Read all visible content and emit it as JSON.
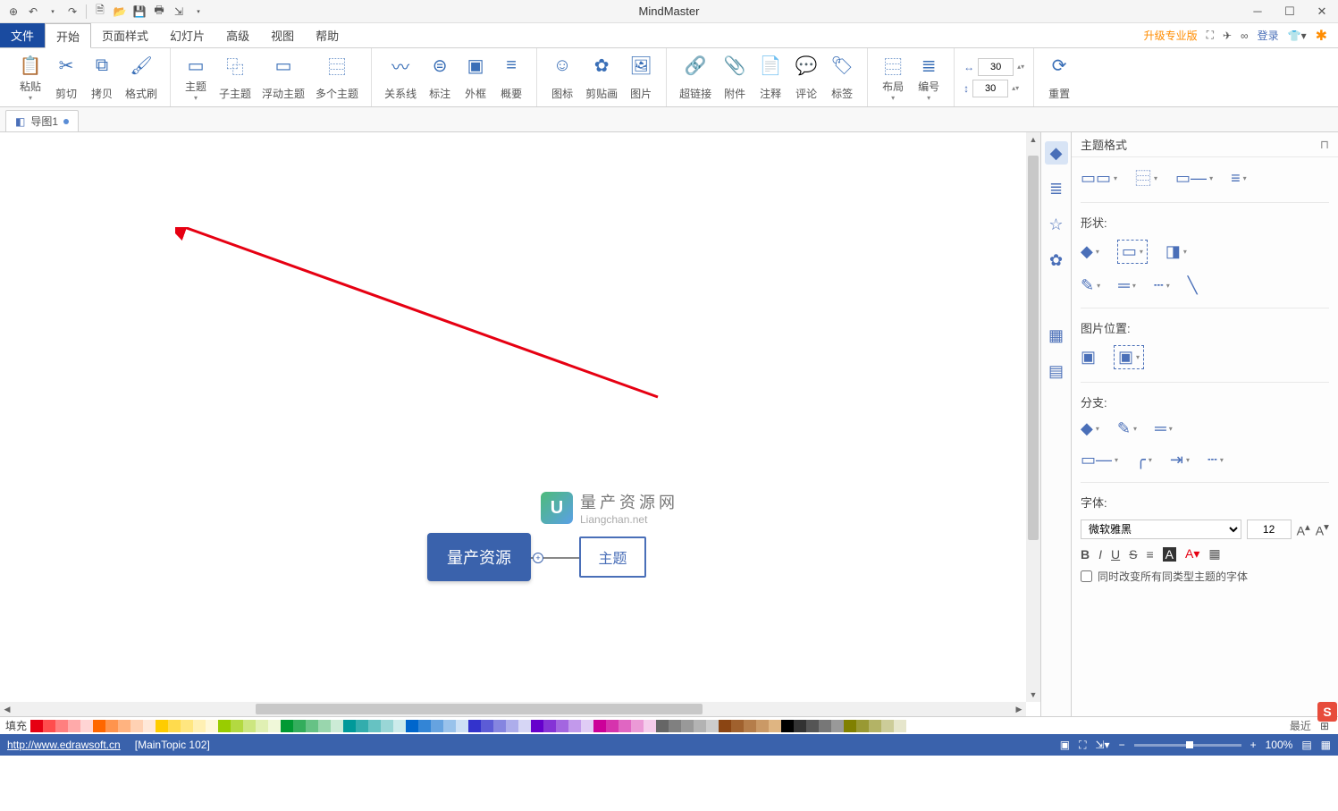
{
  "app_title": "MindMaster",
  "qat": {
    "undo_tip": "↶",
    "redo_tip": "↷"
  },
  "menu": {
    "file": "文件",
    "items": [
      "开始",
      "页面样式",
      "幻灯片",
      "高级",
      "视图",
      "帮助"
    ],
    "upgrade": "升级专业版",
    "login": "登录"
  },
  "ribbon": {
    "paste": "粘贴",
    "cut": "剪切",
    "copy": "拷贝",
    "format_painter": "格式刷",
    "topic": "主题",
    "subtopic": "子主题",
    "float_topic": "浮动主题",
    "multi_topic": "多个主题",
    "relation": "关系线",
    "callout": "标注",
    "boundary": "外框",
    "summary": "概要",
    "icon": "图标",
    "clipart": "剪贴画",
    "image": "图片",
    "hyperlink": "超链接",
    "attachment": "附件",
    "note": "注释",
    "comment": "评论",
    "tag": "标签",
    "layout": "布局",
    "numbering": "编号",
    "width_val": "30",
    "height_val": "30",
    "reset": "重置"
  },
  "doc_tab": {
    "name": "导图1"
  },
  "canvas": {
    "root_text": "量产资源",
    "child_text": "主题",
    "wm_cn": "量产资源网",
    "wm_url": "Liangchan.net",
    "wm_logo_letter": "U"
  },
  "panel": {
    "title": "主题格式",
    "shape": "形状:",
    "img_pos": "图片位置:",
    "branch": "分支:",
    "font": "字体:",
    "font_family": "微软雅黑",
    "font_size": "12",
    "font_bigger": "A↑",
    "font_smaller": "A↓",
    "style_bold": "B",
    "style_italic": "I",
    "style_underline": "U",
    "style_strike": "S",
    "cb_text": "同时改变所有同类型主题的字体"
  },
  "colorstrip": {
    "fill": "填充",
    "recent": "最近",
    "colors": [
      "#e60012",
      "#ff4d4d",
      "#ff7f7f",
      "#ffaaaa",
      "#ffd4d4",
      "#ff6600",
      "#ff944d",
      "#ffb380",
      "#ffd1b3",
      "#ffe8d9",
      "#ffcc00",
      "#ffdb4d",
      "#ffe680",
      "#fff0b3",
      "#fff8d9",
      "#99cc00",
      "#b3d941",
      "#cce680",
      "#e0f0b3",
      "#f0f8d9",
      "#009933",
      "#33ad5c",
      "#66c285",
      "#99d6ad",
      "#ccebd6",
      "#009999",
      "#33adad",
      "#66c2c2",
      "#99d6d6",
      "#ccebeb",
      "#0066cc",
      "#3385d6",
      "#66a3e0",
      "#99c2eb",
      "#cce0f5",
      "#3333cc",
      "#5c5cd6",
      "#8585e0",
      "#adadeb",
      "#d6d6f5",
      "#6600cc",
      "#8533d6",
      "#a366e0",
      "#c299eb",
      "#e0ccf5",
      "#cc0099",
      "#d633ad",
      "#e066c2",
      "#eb99d6",
      "#f5cceb",
      "#666666",
      "#808080",
      "#999999",
      "#b3b3b3",
      "#cccccc",
      "#8b4513",
      "#a0612e",
      "#b57d4a",
      "#ca9966",
      "#dfb582",
      "#000000",
      "#333333",
      "#555555",
      "#777777",
      "#999999",
      "#808000",
      "#999933",
      "#b3b366",
      "#cccc99",
      "#e6e6cc"
    ]
  },
  "status": {
    "url": "http://www.edrawsoft.cn",
    "info": "[MainTopic 102]",
    "zoom": "100%"
  }
}
